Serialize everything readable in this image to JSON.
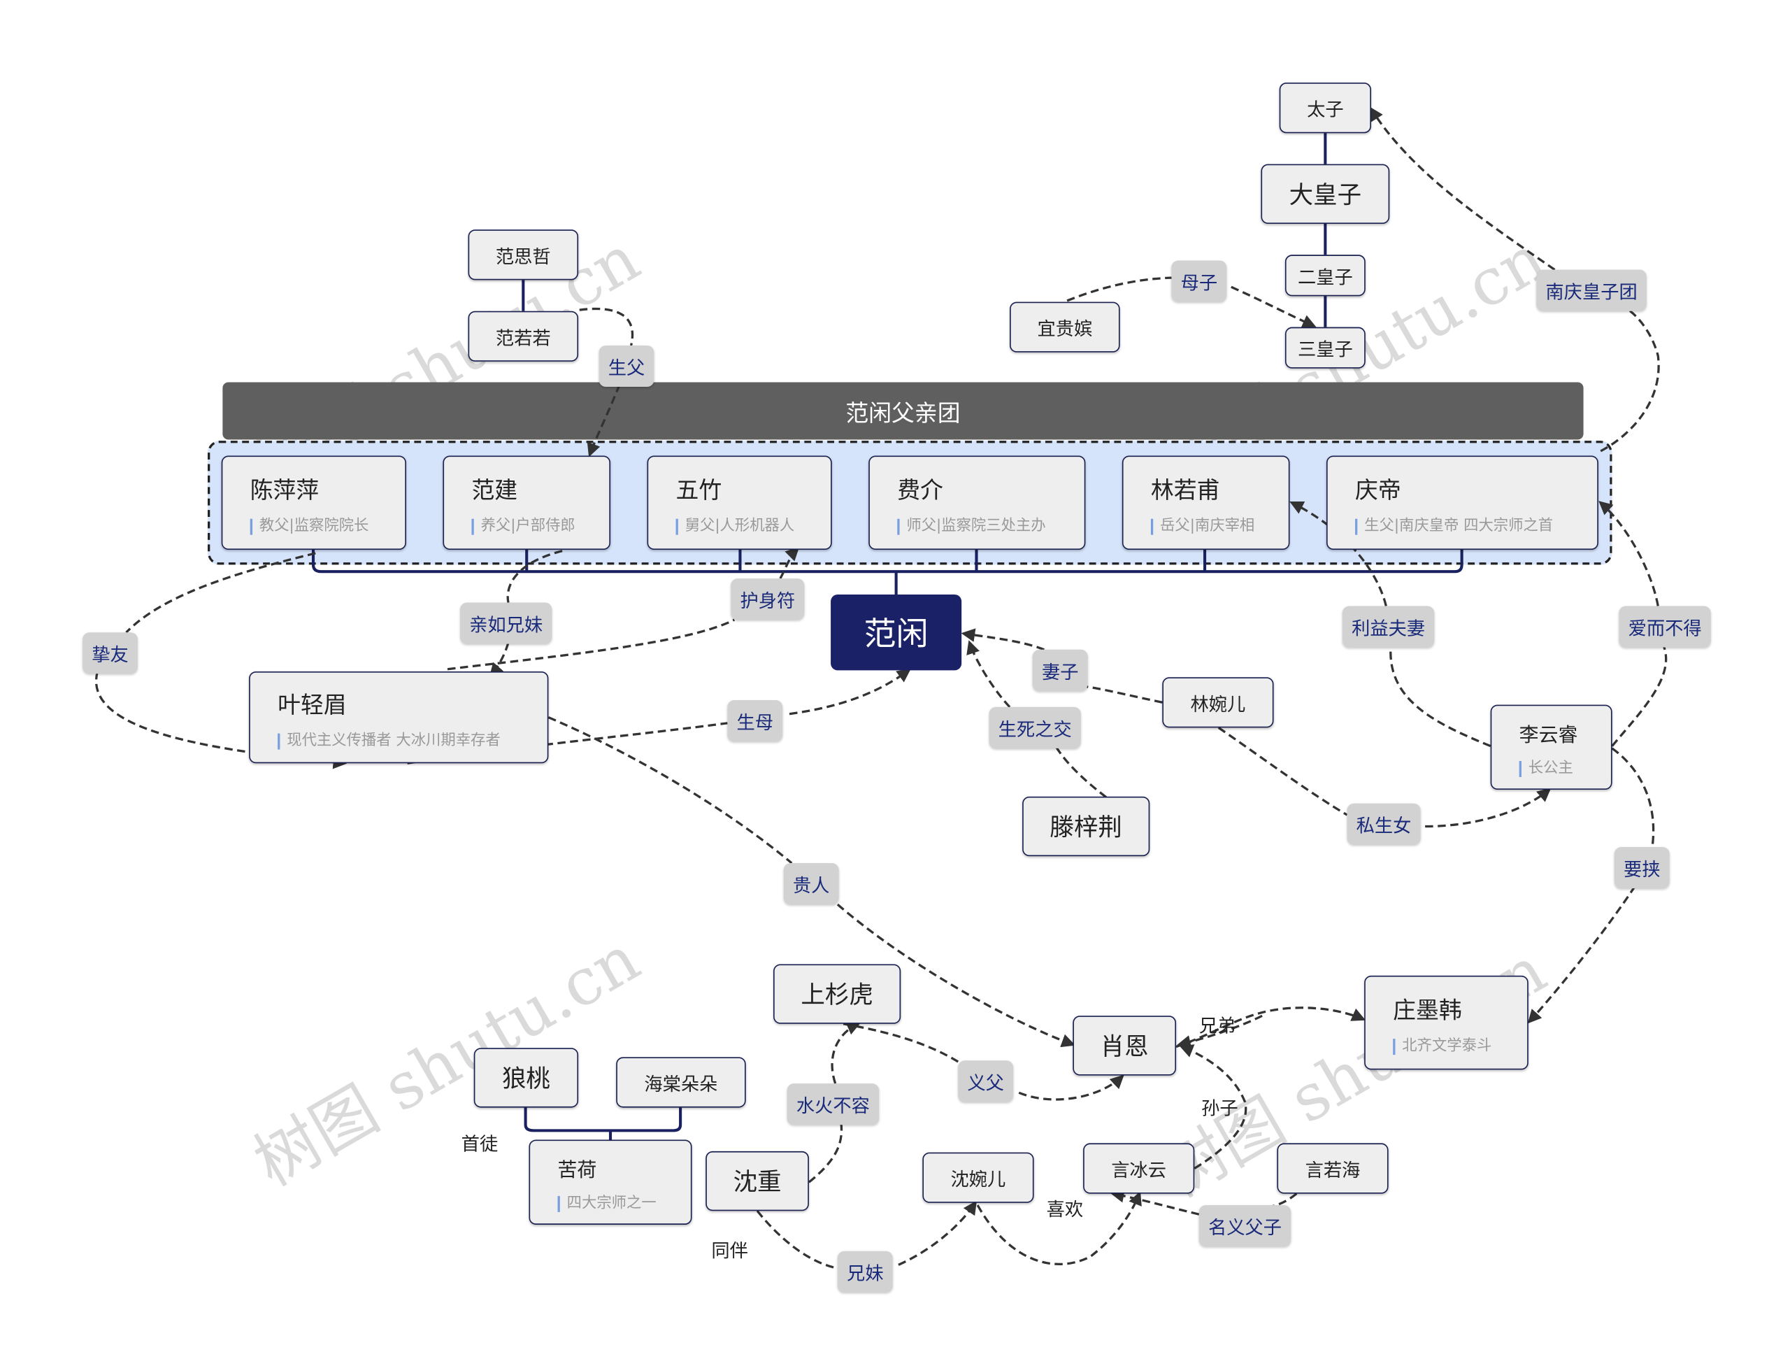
{
  "watermark": "树图 shutu.cn",
  "colors": {
    "root": "#1a2166",
    "group_bar": "#5f5f5f",
    "group_bg": "#d6e4fb",
    "label_bg": "#d2d2d2",
    "label_text": "#1a2a7a"
  },
  "group": {
    "title": "范闲父亲团",
    "members": [
      {
        "name": "陈萍萍",
        "desc": "教父|监察院院长"
      },
      {
        "name": "范建",
        "desc": "养父|户部侍郎"
      },
      {
        "name": "五竹",
        "desc": "舅父|人形机器人"
      },
      {
        "name": "费介",
        "desc": "师父|监察院三处主办"
      },
      {
        "name": "林若甫",
        "desc": "岳父|南庆宰相"
      },
      {
        "name": "庆帝",
        "desc": "生父|南庆皇帝 四大宗师之首"
      }
    ]
  },
  "root": "范闲",
  "nodes": {
    "taizi": "太子",
    "dahuangzi": "大皇子",
    "erhuangzi": "二皇子",
    "sanhuangzi": "三皇子",
    "yiguipin": "宜贵嫔",
    "fansizhe": "范思哲",
    "fanruoruo": "范若若",
    "yeqingmei": {
      "name": "叶轻眉",
      "desc": "现代主义传播者 大冰川期幸存者"
    },
    "linwaner": "林婉儿",
    "tengzijing": "滕梓荆",
    "liyunrui": {
      "name": "李云睿",
      "desc": "长公主"
    },
    "zhuangmohan": {
      "name": "庄墨韩",
      "desc": "北齐文学泰斗"
    },
    "xiaoen": "肖恩",
    "shangshanhu": "上杉虎",
    "langtao": "狼桃",
    "haitang": "海棠朵朵",
    "kuhe": {
      "name": "苦荷",
      "desc": "四大宗师之一"
    },
    "shenzhong": "沈重",
    "shenwaner": "沈婉儿",
    "yanbingyun": "言冰云",
    "yanruohai": "言若海"
  },
  "labels": {
    "shengfu": "生父",
    "muzi": "母子",
    "nanqing": "南庆皇子团",
    "qinru": "亲如兄妹",
    "hushen": "护身符",
    "zhiyou": "挚友",
    "shengmu": "生母",
    "qizi": "妻子",
    "shengsi": "生死之交",
    "liyi": "利益夫妻",
    "aier": "爱而不得",
    "sisheng": "私生女",
    "yaoxie": "要挟",
    "guiren": "贵人",
    "yifu": "义父",
    "shuihuo": "水火不容",
    "xiongmei": "兄妹",
    "mingyi": "名义父子"
  },
  "plain_labels": {
    "xiongdi": "兄弟",
    "sunzi": "孙子",
    "shoutu": "首徒",
    "tongban": "同伴",
    "xihuan": "喜欢"
  }
}
